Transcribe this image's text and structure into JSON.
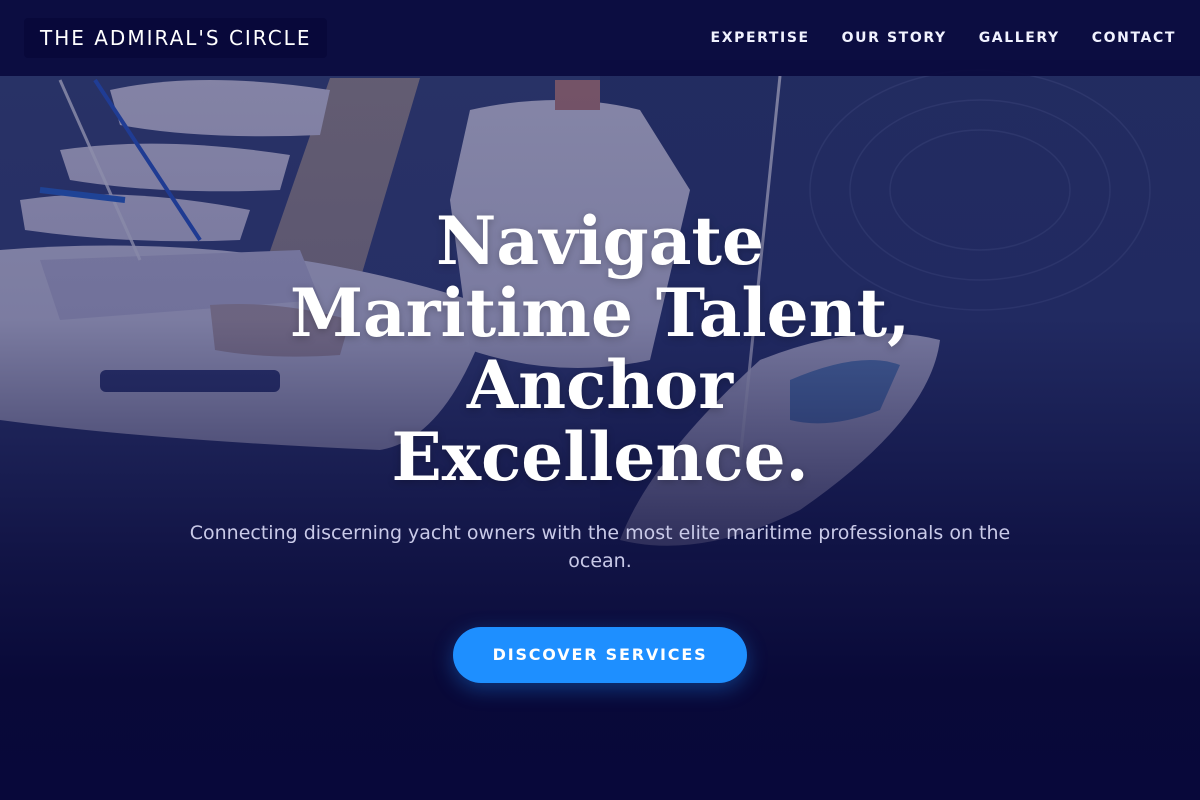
{
  "brand": {
    "name": "THE ADMIRAL'S CIRCLE"
  },
  "nav": {
    "items": [
      {
        "label": "EXPERTISE"
      },
      {
        "label": "OUR STORY"
      },
      {
        "label": "GALLERY"
      },
      {
        "label": "CONTACT"
      }
    ]
  },
  "hero": {
    "title": "Navigate Maritime Talent, Anchor Excellence.",
    "subtitle": "Connecting discerning yacht owners with the most elite maritime professionals on the ocean.",
    "cta_label": "DISCOVER SERVICES"
  },
  "colors": {
    "header_bg": "#0a0a3e",
    "page_bg": "#08083a",
    "cta_bg": "#1e8fff",
    "text": "#ffffff",
    "subtitle_text": "#c9cae8"
  }
}
